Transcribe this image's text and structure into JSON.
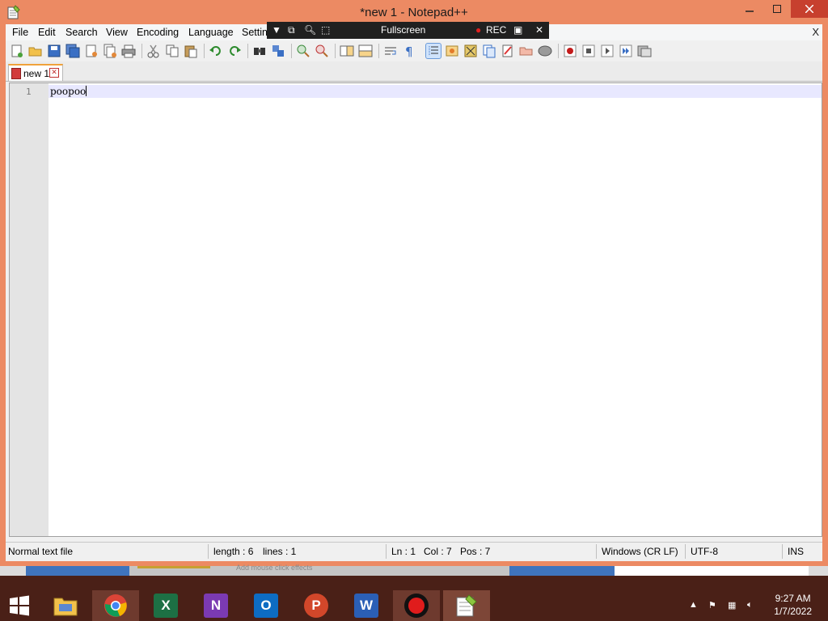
{
  "window": {
    "title": "*new 1 - Notepad++"
  },
  "menu": [
    "File",
    "Edit",
    "Search",
    "View",
    "Encoding",
    "Language",
    "Settin"
  ],
  "menu_close": "X",
  "recorder": {
    "mode": "Fullscreen",
    "rec": "REC"
  },
  "tab": {
    "label": "new 1"
  },
  "editor": {
    "line_number": "1",
    "text": "poopoo"
  },
  "status": {
    "file_type": "Normal text file",
    "length": "length : 6",
    "lines": "lines : 1",
    "ln": "Ln : 1",
    "col": "Col : 7",
    "pos": "Pos : 7",
    "eol": "Windows (CR LF)",
    "encoding": "UTF-8",
    "mode": "INS"
  },
  "background_strip": {
    "text": "Add mouse click effects"
  },
  "taskbar": {
    "apps": [
      {
        "name": "file-explorer",
        "glyph": ""
      },
      {
        "name": "chrome",
        "glyph": ""
      },
      {
        "name": "excel",
        "glyph": "X"
      },
      {
        "name": "onenote",
        "glyph": "N"
      },
      {
        "name": "outlook",
        "glyph": "O"
      },
      {
        "name": "powerpoint",
        "glyph": "P"
      },
      {
        "name": "word",
        "glyph": "W"
      },
      {
        "name": "recorder",
        "glyph": ""
      },
      {
        "name": "notepad-plus-plus",
        "glyph": ""
      }
    ],
    "time": "9:27 AM",
    "date": "1/7/2022"
  },
  "colors": {
    "accent": "#ec8a63",
    "taskbar": "#4a2017",
    "close": "#c7402e"
  }
}
